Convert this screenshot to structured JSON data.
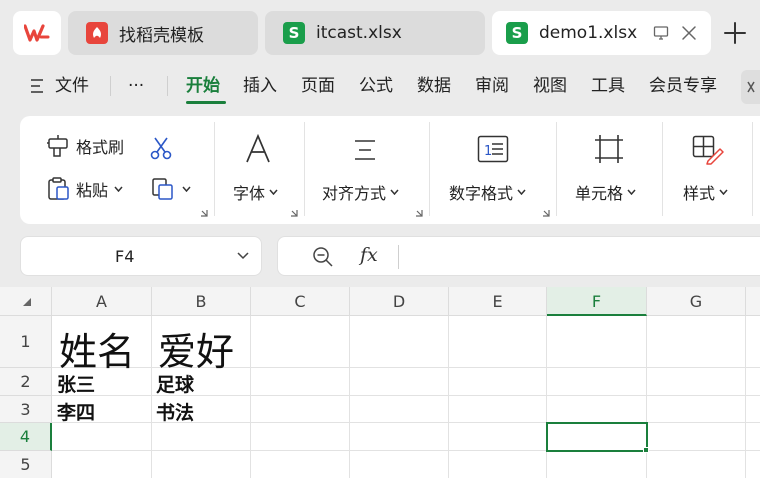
{
  "tabs": [
    {
      "label": "找稻壳模板",
      "icon": "docer-icon",
      "color": "#e8453c",
      "active": false
    },
    {
      "label": "itcast.xlsx",
      "icon": "spreadsheet-icon",
      "color": "#1a9e4b",
      "active": false
    },
    {
      "label": "demo1.xlsx",
      "icon": "spreadsheet-icon",
      "color": "#1a9e4b",
      "active": true
    }
  ],
  "menu": {
    "file": "文件",
    "more": "···",
    "items": [
      "开始",
      "插入",
      "页面",
      "公式",
      "数据",
      "审阅",
      "视图",
      "工具",
      "会员专享"
    ],
    "active": "开始"
  },
  "ribbon": {
    "format_painter": "格式刷",
    "paste": "粘贴",
    "font": "字体",
    "align": "对齐方式",
    "number_format": "数字格式",
    "cell": "单元格",
    "style": "样式"
  },
  "formula_bar": {
    "name_box": "F4",
    "fx": "fx",
    "value": ""
  },
  "sheet": {
    "columns": [
      "A",
      "B",
      "C",
      "D",
      "E",
      "F",
      "G"
    ],
    "rows": [
      "1",
      "2",
      "3",
      "4",
      "5"
    ],
    "cells": {
      "A1": "姓名",
      "B1": "爱好",
      "A2": "张三",
      "B2": "足球",
      "A3": "李四",
      "B3": "书法"
    },
    "selected": "F4"
  },
  "colors": {
    "accent": "#1a7f3c",
    "wps_red": "#e8453c"
  }
}
